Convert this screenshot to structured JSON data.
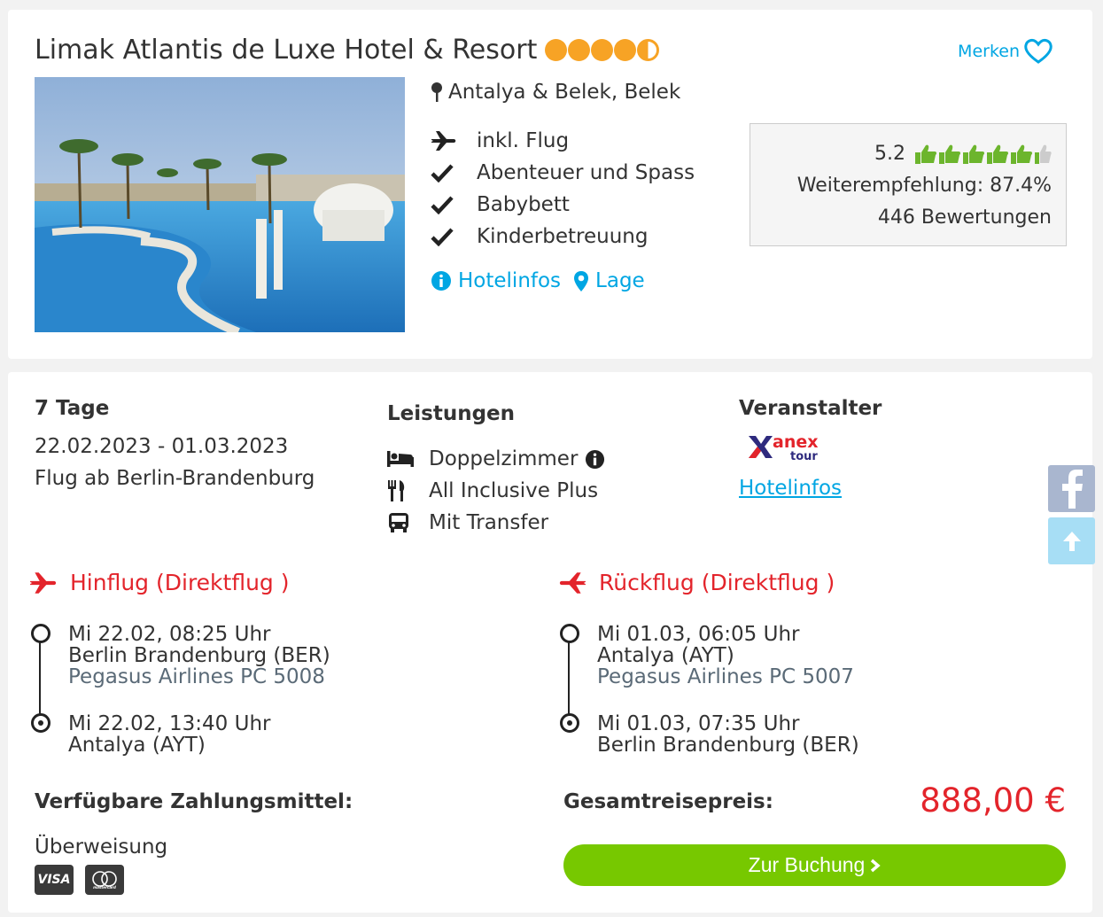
{
  "hotel": {
    "name": "Limak Atlantis de Luxe Hotel & Resort",
    "stars": 4.5,
    "merken_label": "Merken",
    "location": "Antalya & Belek, Belek",
    "features": [
      "inkl. Flug",
      "Abenteuer und Spass",
      "Babybett",
      "Kinderbetreuung"
    ],
    "links": {
      "hotelinfos": "Hotelinfos",
      "lage": "Lage"
    }
  },
  "rating": {
    "score": "5.2",
    "thumbs": 5.5,
    "recommendation": "Weiterempfehlung: 87.4%",
    "reviews": "446 Bewertungen"
  },
  "trip": {
    "duration": "7 Tage",
    "dates": "22.02.2023 - 01.03.2023",
    "departure": "Flug ab Berlin-Brandenburg"
  },
  "leistungen": {
    "title": "Leistungen",
    "items": [
      {
        "icon": "bed-icon",
        "label": "Doppelzimmer"
      },
      {
        "icon": "cutlery-icon",
        "label": "All Inclusive Plus"
      },
      {
        "icon": "bus-icon",
        "label": "Mit Transfer"
      }
    ]
  },
  "veranstalter": {
    "title": "Veranstalter",
    "logo_text": "anex tour",
    "link": "Hotelinfos"
  },
  "hinflug": {
    "title": "Hinflug (Direktflug )",
    "dep_time": "Mi 22.02, 08:25 Uhr",
    "dep_airport": "Berlin Brandenburg (BER)",
    "airline": "Pegasus Airlines PC 5008",
    "arr_time": "Mi 22.02, 13:40 Uhr",
    "arr_airport": "Antalya (AYT)"
  },
  "rueckflug": {
    "title": "Rückflug (Direktflug )",
    "dep_time": "Mi 01.03, 06:05 Uhr",
    "dep_airport": "Antalya (AYT)",
    "airline": "Pegasus Airlines PC 5007",
    "arr_time": "Mi 01.03, 07:35 Uhr",
    "arr_airport": "Berlin Brandenburg (BER)"
  },
  "payment": {
    "title": "Verfügbare Zahlungsmittel:",
    "method": "Überweisung",
    "cards": [
      "VISA",
      "mastercard"
    ]
  },
  "price": {
    "label": "Gesamtreisepreis:",
    "value": "888,00 €",
    "button": "Zur Buchung"
  },
  "colors": {
    "accent": "#00a6e3",
    "price": "#e3242b",
    "button": "#77c800",
    "stars": "#f7a325",
    "thumbs": "#6cb52d"
  }
}
